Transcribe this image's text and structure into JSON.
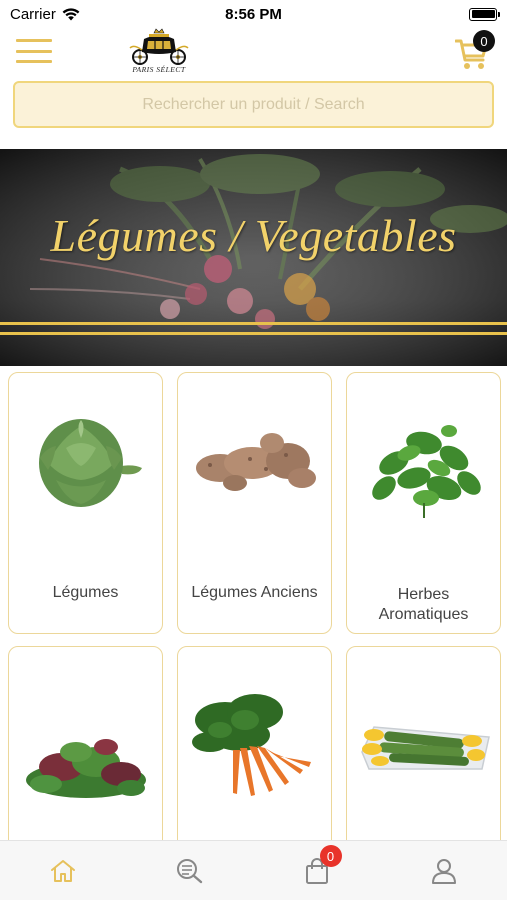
{
  "status_bar": {
    "carrier": "Carrier",
    "time": "8:56 PM"
  },
  "header": {
    "menu_icon": "hamburger-icon",
    "logo_text": "PARIS SÉLECT",
    "cart_icon": "cart-icon",
    "cart_count": "0"
  },
  "search": {
    "placeholder": "Rechercher un produit / Search",
    "value": ""
  },
  "banner": {
    "title": "Légumes / Vegetables"
  },
  "categories": [
    {
      "label": "Légumes",
      "image": "artichoke"
    },
    {
      "label": "Légumes Anciens",
      "image": "jerusalem-artichoke"
    },
    {
      "label_line1": "Herbes",
      "label_line2": "Aromatiques",
      "image": "mint"
    },
    {
      "label": "",
      "image": "salad-mix"
    },
    {
      "label": "",
      "image": "carrots"
    },
    {
      "label": "",
      "image": "zucchini-flowers"
    }
  ],
  "tabbar": {
    "items": [
      {
        "name": "home",
        "icon": "home-icon",
        "active": true
      },
      {
        "name": "search",
        "icon": "search-list-icon",
        "active": false
      },
      {
        "name": "bag",
        "icon": "shopping-bag-icon",
        "badge": "0",
        "active": false
      },
      {
        "name": "account",
        "icon": "user-icon",
        "active": false
      }
    ]
  },
  "colors": {
    "accent": "#e6c15c",
    "search_bg": "#fbf2d8",
    "badge_red": "#e8332a",
    "card_border": "#ecd79a"
  }
}
